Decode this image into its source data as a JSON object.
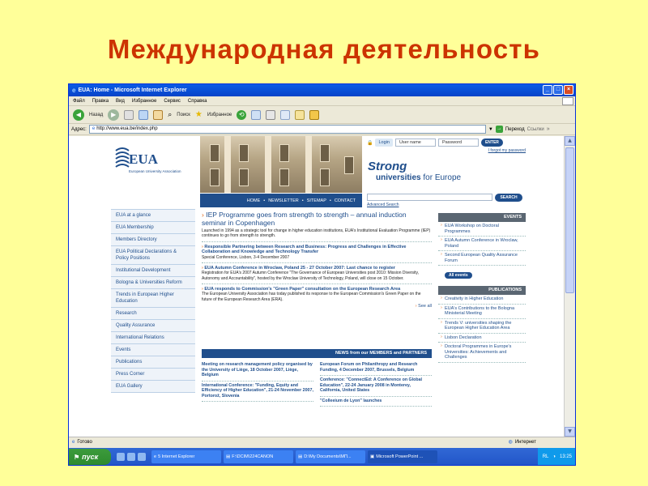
{
  "slide_title": "Международная деятельность",
  "window": {
    "title": "EUA: Home - Microsoft Internet Explorer",
    "menu": [
      "Файл",
      "Правка",
      "Вид",
      "Избранное",
      "Сервис",
      "Справка"
    ],
    "toolbar": {
      "back": "Назад",
      "search": "Поиск",
      "favorites": "Избранное"
    },
    "address_label": "Адрес:",
    "address_value": "http://www.eua.be/index.php",
    "go_label": "Переход",
    "links_label": "Ссылки",
    "status_left": "Готово",
    "status_zone": "Интернет"
  },
  "taskbar": {
    "start": "пуск",
    "tasks": [
      "5 Internet Explorer",
      "F:\\DCIM\\224CANON",
      "D:\\My Documents\\МП...",
      "Microsoft PowerPoint ..."
    ],
    "lang": "RL",
    "time": "13:25"
  },
  "site": {
    "logo": "EUA",
    "logo_sub": "European University Association",
    "login_label": "Login",
    "username_placeholder": "User name",
    "password_placeholder": "Password",
    "enter": "ENTER",
    "forgot": "I forgot my password",
    "slogan_line1": "Strong",
    "slogan_line2_a": "universities",
    "slogan_line2_b": " for Europe",
    "nav": [
      "HOME",
      "NEWSLETTER",
      "SITEMAP",
      "CONTACT"
    ],
    "search_btn": "SEARCH",
    "adv_search": "Advanced Search",
    "left_nav": [
      "EUA at a glance",
      "EUA Membership",
      "Members Directory",
      "EUA Political Declarations & Policy Positions",
      "Institutional Development",
      "Bologna & Universities Reform",
      "Trends in European Higher Education",
      "Research",
      "Quality Assurance",
      "International Relations",
      "Events",
      "Publications",
      "Press Corner",
      "EUA Gallery"
    ],
    "headline": "IEP Programme goes from strength to strength – annual induction seminar in Copenhagen",
    "headline_text": "Launched in 1994 as a strategic tool for change in higher education institutions, EUA's Institutional Evaluation Programme (IEP) continues to go from strength to strength.",
    "item2_title": "Responsible Partnering between Research and Business: Progress and Challenges in Effective Collaboration and Knowledge and Technology Transfer",
    "item2_text": "Special Conference, Lisbon, 3-4 December 2007",
    "item3_title": "EUA Autumn Conference in Wroclaw, Poland 25 - 27 October 2007: Last chance to register",
    "item3_text": "Registration for EUA's 2007 Autumn Conference \"The Governance of European Universities post 2010: Mission Diversity, Autonomy and Accountability\", hosted by the Wroclaw University of Technology, Poland, will close on 15 October.",
    "item4_title": "EUA responds to Commission's \"Green Paper\" consultation on the European Research Area",
    "item4_text": "The European University Association has today published its response to the European Commission's Green Paper on the future of the European Research Area (ERA).",
    "see_all": "See all",
    "news_bar": "NEWS from our MEMBERS and PARTNERS",
    "news_left": [
      "Meeting on research management policy organised by the University of Liège, 18 October 2007, Liège, Belgium",
      "International Conference: \"Funding, Equity and Efficiency of Higher Education\", 21-24 November 2007, Portorož, Slovenia"
    ],
    "news_right": [
      "European Forum on Philanthropy and Research Funding, 4 December 2007, Brussels, Belgium",
      "Conference: \"ConnectEd: A Conference on Global Education\", 22-24 January 2008 in Monterey, California, United States",
      "\"Colleeium de Lyon\" launches"
    ],
    "events_head": "EVENTS",
    "events": [
      "EUA Workshop on Doctoral Programmes",
      "EUA Autumn Conference in Wroclaw, Poland",
      "Second European Quality Assurance Forum"
    ],
    "all_events": "All events",
    "publications_head": "PUBLICATIONS",
    "publications": [
      "Creativity in Higher Education",
      "EUA's Contributions to the Bologna Ministerial Meeting",
      "Trends V: universities shaping the European Higher Education Area",
      "Lisbon Declaration",
      "Doctoral Programmes in Europe's Universities: Achievements and Challenges"
    ]
  }
}
